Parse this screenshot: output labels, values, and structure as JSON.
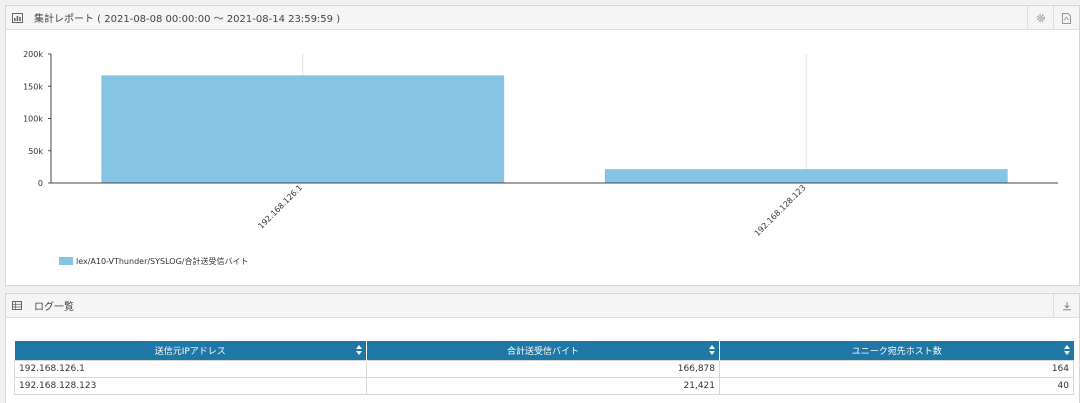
{
  "chart_panel": {
    "title": "集計レポート ( 2021-08-08 00:00:00 ～ 2021-08-14 23:59:59 )",
    "icons": {
      "header": "bar-chart-icon",
      "settings": "gear-icon",
      "export": "pdf-icon"
    }
  },
  "chart_data": {
    "type": "bar",
    "categories": [
      "192.168.126.1",
      "192.168.128.123"
    ],
    "series": [
      {
        "name": "lex/A10-VThunder/SYSLOG/合計送受信バイト",
        "values": [
          166878,
          21421
        ],
        "color": "#85c4e2"
      }
    ],
    "ylim": [
      0,
      200000
    ],
    "yticks": [
      "0",
      "50k",
      "100k",
      "150k",
      "200k"
    ],
    "grid": true,
    "legend_position": "bottom-left"
  },
  "log_panel": {
    "title": "ログ一覧",
    "icons": {
      "header": "table-icon",
      "download": "download-icon"
    },
    "columns": [
      "送信元IPアドレス",
      "合計送受信バイト",
      "ユニーク宛先ホスト数"
    ],
    "rows": [
      [
        "192.168.126.1",
        "166,878",
        "164"
      ],
      [
        "192.168.128.123",
        "21,421",
        "40"
      ]
    ]
  },
  "colors": {
    "header_bg": "#1f77a5",
    "bar": "#85c4e2"
  }
}
